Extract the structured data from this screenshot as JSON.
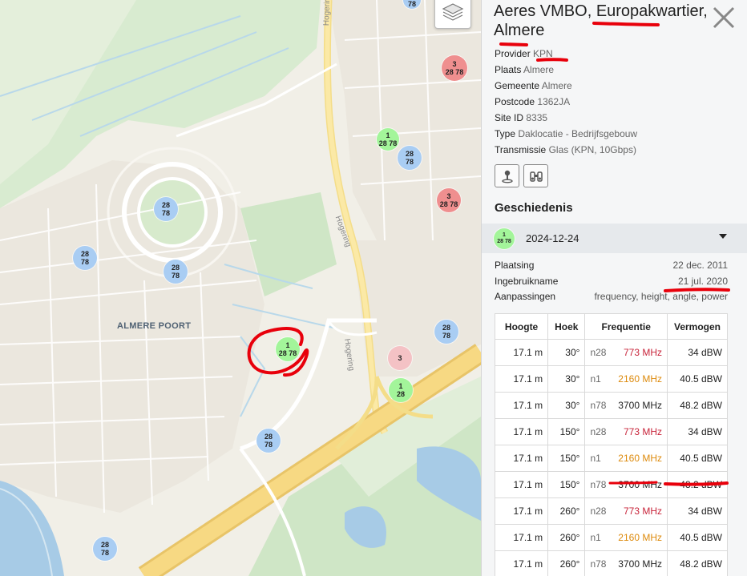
{
  "map": {
    "area_label": "ALMERE POORT",
    "road_labels": [
      "Hogering",
      "Hogering",
      "Hogering"
    ],
    "markers": [
      {
        "lines": [
          "28",
          "78"
        ],
        "color": "blue"
      },
      {
        "lines": [
          "3",
          "28 78"
        ],
        "color": "red"
      },
      {
        "lines": [
          "1",
          "28 78"
        ],
        "color": "green"
      },
      {
        "lines": [
          "28",
          "78"
        ],
        "color": "blue"
      },
      {
        "lines": [
          "28",
          "78"
        ],
        "color": "blue"
      },
      {
        "lines": [
          "3",
          "28 78"
        ],
        "color": "red"
      },
      {
        "lines": [
          "28",
          "78"
        ],
        "color": "blue"
      },
      {
        "lines": [
          "28",
          "78"
        ],
        "color": "blue"
      },
      {
        "lines": [
          "1",
          "28 78"
        ],
        "color": "green"
      },
      {
        "lines": [
          "28",
          "78"
        ],
        "color": "blue"
      },
      {
        "lines": [
          "3"
        ],
        "color": "pink"
      },
      {
        "lines": [
          "1",
          "28"
        ],
        "color": "green"
      },
      {
        "lines": [
          "28",
          "78"
        ],
        "color": "blue"
      },
      {
        "lines": [
          "28",
          "78"
        ],
        "color": "blue"
      }
    ],
    "layers_icon": "layers-icon"
  },
  "panel": {
    "title": "Aeres VMBO, Europakwartier, Almere",
    "close_icon": "close-icon",
    "properties": [
      {
        "key": "Provider",
        "value": "KPN"
      },
      {
        "key": "Plaats",
        "value": "Almere"
      },
      {
        "key": "Gemeente",
        "value": "Almere"
      },
      {
        "key": "Postcode",
        "value": "1362JA"
      },
      {
        "key": "Site ID",
        "value": "8335"
      },
      {
        "key": "Type",
        "value": "Daklocatie - Bedrijfsgebouw"
      },
      {
        "key": "Transmissie",
        "value": "Glas (KPN, 10Gbps)"
      }
    ],
    "buttons": [
      "streetview-icon",
      "binoculars-icon"
    ],
    "history": {
      "heading": "Geschiedenis",
      "badge": [
        "1",
        "28 78"
      ],
      "date": "2024-12-24",
      "details": [
        {
          "key": "Plaatsing",
          "value": "22 dec. 2011"
        },
        {
          "key": "Ingebruikname",
          "value": "21 jul. 2020"
        },
        {
          "key": "Aanpassingen",
          "value": "frequency, height, angle, power"
        }
      ]
    },
    "table": {
      "headers": [
        "Hoogte",
        "Hoek",
        "Frequentie",
        "Vermogen"
      ],
      "rows": [
        {
          "height": "17.1 m",
          "angle": "30°",
          "band": "n28",
          "freq": "773 MHz",
          "power": "34 dBW",
          "angle_color": "red",
          "freq_color": "red"
        },
        {
          "height": "17.1 m",
          "angle": "30°",
          "band": "n1",
          "freq": "2160 MHz",
          "power": "40.5 dBW",
          "angle_color": "red",
          "freq_color": "orange"
        },
        {
          "height": "17.1 m",
          "angle": "30°",
          "band": "n78",
          "freq": "3700 MHz",
          "power": "48.2 dBW",
          "angle_color": "red",
          "freq_color": "dark"
        },
        {
          "height": "17.1 m",
          "angle": "150°",
          "band": "n28",
          "freq": "773 MHz",
          "power": "34 dBW",
          "angle_color": "green",
          "freq_color": "red"
        },
        {
          "height": "17.1 m",
          "angle": "150°",
          "band": "n1",
          "freq": "2160 MHz",
          "power": "40.5 dBW",
          "angle_color": "green",
          "freq_color": "orange"
        },
        {
          "height": "17.1 m",
          "angle": "150°",
          "band": "n78",
          "freq": "3700 MHz",
          "power": "48.2 dBW",
          "angle_color": "green",
          "freq_color": "dark"
        },
        {
          "height": "17.1 m",
          "angle": "260°",
          "band": "n28",
          "freq": "773 MHz",
          "power": "34 dBW",
          "angle_color": "yellow",
          "freq_color": "red"
        },
        {
          "height": "17.1 m",
          "angle": "260°",
          "band": "n1",
          "freq": "2160 MHz",
          "power": "40.5 dBW",
          "angle_color": "yellow",
          "freq_color": "orange"
        },
        {
          "height": "17.1 m",
          "angle": "260°",
          "band": "n78",
          "freq": "3700 MHz",
          "power": "48.2 dBW",
          "angle_color": "yellow",
          "freq_color": "dark"
        }
      ]
    }
  },
  "colors": {
    "marker_blue": "#a9cdf3",
    "marker_green": "#a3f59a",
    "marker_red": "#ef8f8f",
    "marker_pink": "#f4c2c5",
    "annotation_red": "#e8000b",
    "angle_red": "#c8243a",
    "angle_green": "#27a52e",
    "angle_yellow": "#ecce05",
    "freq_orange": "#dd8a0c"
  }
}
